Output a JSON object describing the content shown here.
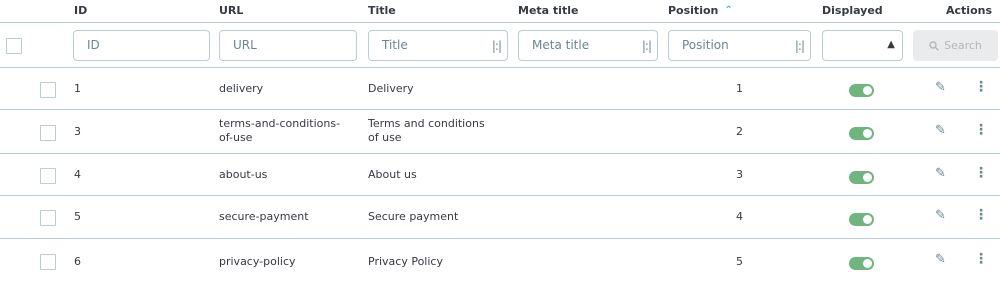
{
  "headers": {
    "id": "ID",
    "url": "URL",
    "title": "Title",
    "meta_title": "Meta title",
    "position": "Position",
    "position_sort_icon": "chevron-up-icon",
    "displayed": "Displayed",
    "actions": "Actions"
  },
  "filters": {
    "id_placeholder": "ID",
    "url_placeholder": "URL",
    "title_placeholder": "Title",
    "meta_title_placeholder": "Meta title",
    "position_placeholder": "Position",
    "displayed_value": "",
    "search_label": "Search"
  },
  "rows": [
    {
      "id": "1",
      "url": "delivery",
      "title": "Delivery",
      "meta_title": "",
      "position": "1",
      "displayed": true
    },
    {
      "id": "3",
      "url": "terms-and-conditions-of-use",
      "title": "Terms and conditions of use",
      "meta_title": "",
      "position": "2",
      "displayed": true
    },
    {
      "id": "4",
      "url": "about-us",
      "title": "About us",
      "meta_title": "",
      "position": "3",
      "displayed": true
    },
    {
      "id": "5",
      "url": "secure-payment",
      "title": "Secure payment",
      "meta_title": "",
      "position": "4",
      "displayed": true
    },
    {
      "id": "6",
      "url": "privacy-policy",
      "title": "Privacy Policy",
      "meta_title": "",
      "position": "5",
      "displayed": true
    }
  ],
  "colors": {
    "accent": "#25b9d7",
    "toggle_on": "#70b580",
    "border": "#bbcdd2"
  }
}
